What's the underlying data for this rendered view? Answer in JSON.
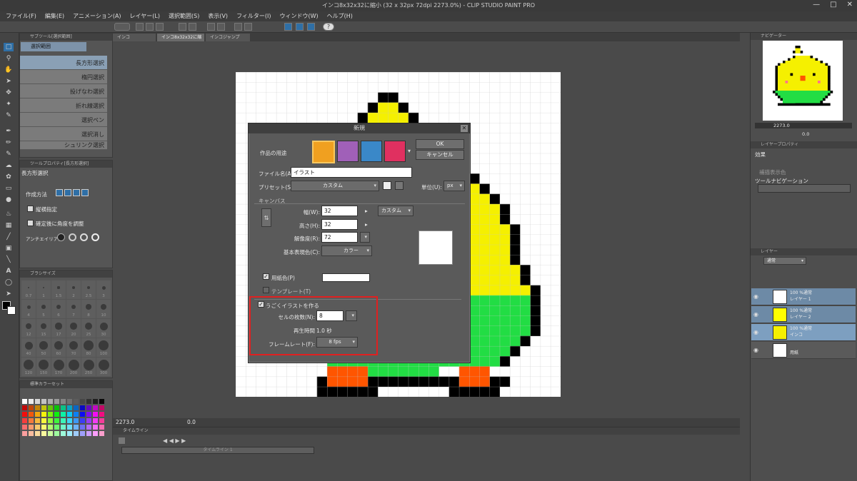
{
  "window": {
    "title": "インコ8x32x32に縮小 (32 x 32px 72dpi 2273.0%) - CLIP STUDIO PAINT PRO"
  },
  "menu": [
    "ファイル(F)",
    "編集(E)",
    "アニメーション(A)",
    "レイヤー(L)",
    "選択範囲(S)",
    "表示(V)",
    "フィルター(I)",
    "ウィンドウ(W)",
    "ヘルプ(H)"
  ],
  "doc_tabs": [
    "インコ",
    "インコ8x32x32に縮小",
    "インコジャンプ"
  ],
  "subtool": {
    "panel_title": "サブツール[選択範囲]",
    "group": "選択範囲",
    "items": [
      "長方形選択",
      "楕円選択",
      "投げなわ選択",
      "折れ線選択",
      "選択ペン",
      "選択消し",
      "シュリンク選択"
    ]
  },
  "tool_property": {
    "panel_title": "ツールプロパティ[長方形選択]",
    "name": "長方形選択",
    "method_label": "作成方法",
    "aspect_label": "縦横指定",
    "angle_label": "確定後に角度を調整",
    "antialias_label": "アンチエイリアス"
  },
  "brush_size": {
    "panel_title": "ブラシサイズ",
    "values": [
      "0.7",
      "1",
      "1.5",
      "2",
      "2.5",
      "3",
      "4",
      "5",
      "6",
      "7",
      "8",
      "10",
      "12",
      "15",
      "17",
      "20",
      "25",
      "30",
      "40",
      "50",
      "60",
      "70",
      "80",
      "100",
      "120",
      "150",
      "170",
      "200",
      "250",
      "300"
    ]
  },
  "color_set": {
    "panel_title": "標準カラーセット"
  },
  "navigator": {
    "panel_title": "ナビゲーター",
    "zoom": "2273.0",
    "angle": "0.0"
  },
  "layer_property": {
    "panel_title": "レイヤープロパティ",
    "effect_label": "効果",
    "display_color_label": "補描表示色",
    "tool_nav_label": "ツールナビゲーション"
  },
  "layers": {
    "panel_title": "レイヤー",
    "blend": "通常",
    "items": [
      {
        "mode": "100 %通常",
        "name": "レイヤー 1"
      },
      {
        "mode": "100 %通常",
        "name": "レイヤー 2"
      },
      {
        "mode": "100 %通常",
        "name": "インコ"
      },
      {
        "mode": "",
        "name": "用紙"
      }
    ]
  },
  "canvas_status": {
    "zoom": "2273.0",
    "angle": "0.0"
  },
  "timeline": {
    "panel_title": "タイムライン",
    "track": "タイムライン 1"
  },
  "dialog": {
    "title": "新規",
    "purpose_label": "作品の用途",
    "ok": "OK",
    "cancel": "キャンセル",
    "filename_label": "ファイル名(A):",
    "filename_value": "イラスト",
    "preset_label": "プリセット(S):",
    "preset_value": "カスタム",
    "unit_label": "単位(U):",
    "unit_value": "px",
    "canvas_section": "キャンバス",
    "width_label": "幅(W):",
    "width_value": "32",
    "width_preset": "カスタム",
    "height_label": "高さ(H):",
    "height_value": "32",
    "resolution_label": "解像度(R):",
    "resolution_value": "72",
    "basic_color_label": "基本表現色(C):",
    "basic_color_value": "カラー",
    "paper_color_label": "用紙色(P)",
    "template_label": "テンプレート(T)",
    "anim_label": "うごくイラストを作る",
    "cells_label": "セルの枚数(N):",
    "cells_value": "8",
    "playtime_label": "再生時間",
    "playtime_value": "1.0 秒",
    "framerate_label": "フレームレート(F):",
    "framerate_value": "8 fps"
  },
  "colors": {
    "highlight": "#e02020",
    "accent_blue": "#2f6fa6",
    "bird_yellow": "#f5f000",
    "bird_green": "#22dd44",
    "bird_orange": "#ff5500"
  }
}
